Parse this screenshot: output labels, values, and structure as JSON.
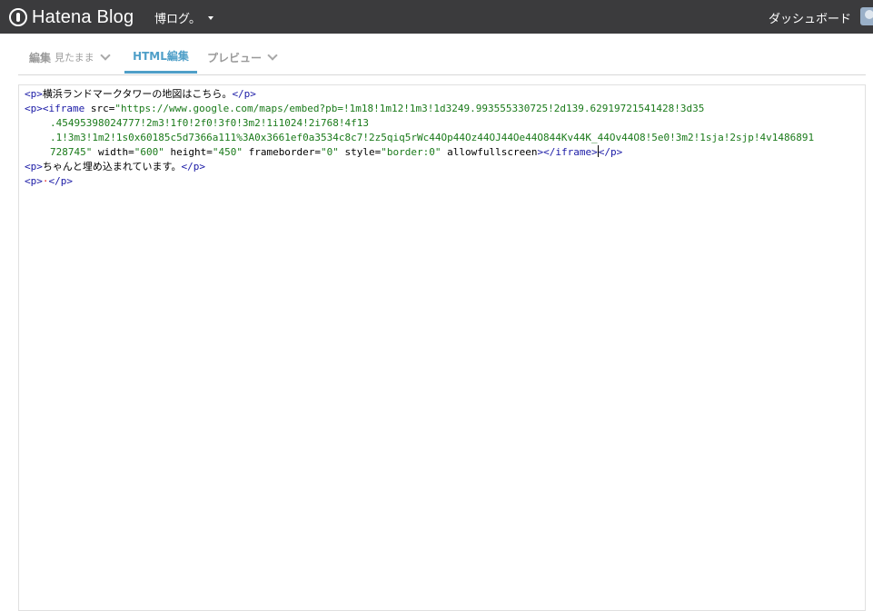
{
  "header": {
    "logo_text": "Hatena Blog",
    "blog_name": "博ログ。",
    "dashboard_label": "ダッシュボード"
  },
  "tabs": [
    {
      "label": "編集",
      "sub": "見たまま",
      "active": false
    },
    {
      "label": "HTML編集",
      "sub": "",
      "active": true
    },
    {
      "label": "プレビュー",
      "sub": "",
      "active": false
    }
  ],
  "code": {
    "l1_open": "<p>",
    "l1_text": "横浜ランドマークタワーの地図はこちら。",
    "l1_close": "</p>",
    "l2_tag": "<p><iframe",
    "l2_attr": " src=",
    "l2_str": "\"https://www.google.com/maps/embed?pb=!1m18!1m12!1m3!1d3249.993555330725!2d139.62919721541428!3d35",
    "l3_str": ".45495398024777!2m3!1f0!2f0!3f0!3m2!1i1024!2i768!4f13",
    "l4_str": ".1!3m3!1m2!1s0x60185c5d7366a111%3A0x3661ef0a3534c8c7!2z5qiq5rWc44Op44Oz44OJ44Oe44O844Kv44K_44Ov44O8!5e0!3m2!1sja!2sjp!4v1486891",
    "l5_str": "728745\"",
    "l5_a1": " width=",
    "l5_s1": "\"600\"",
    "l5_a2": " height=",
    "l5_s2": "\"450\"",
    "l5_a3": " frameborder=",
    "l5_s3": "\"0\"",
    "l5_a4": " style=",
    "l5_s4": "\"border:0\"",
    "l5_a5": " allowfullscreen",
    "l5_tag": "></iframe>",
    "l5_close": "</p>",
    "l6_open": "<p>",
    "l6_text": "ちゃんと埋め込まれています。",
    "l6_close": "</p>",
    "l7_open": "<p>",
    "l7_dot": "·",
    "l7_close": "</p>"
  }
}
